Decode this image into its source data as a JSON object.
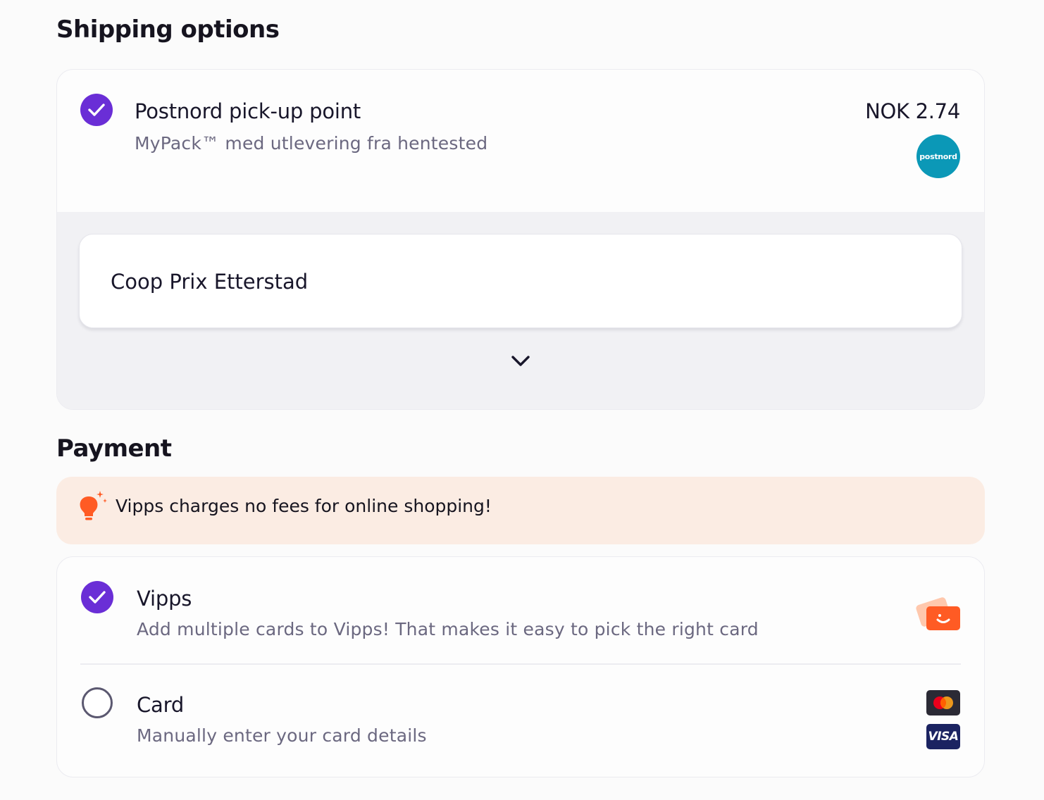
{
  "shipping": {
    "title": "Shipping options",
    "option": {
      "title": "Postnord pick-up point",
      "subtitle": "MyPack™ med utlevering fra hentested",
      "price": "NOK 2.74",
      "selected": true,
      "logo_text": "postnord",
      "logo_color": "#0b98b7"
    },
    "pickup_point": "Coop Prix Etterstad",
    "expand_icon": "chevron-down-icon"
  },
  "payment": {
    "title": "Payment",
    "promo_text": "Vipps charges no fees for online shopping!",
    "promo_icon": "lightbulb-icon",
    "options": [
      {
        "title": "Vipps",
        "subtitle": "Add multiple cards to Vipps! That makes it easy to pick the right card",
        "selected": true,
        "logo": "vipps-logo"
      },
      {
        "title": "Card",
        "subtitle": "Manually enter your card details",
        "selected": false,
        "logos": [
          "mastercard-logo",
          "visa-logo"
        ],
        "visa_text": "VISA"
      }
    ]
  },
  "colors": {
    "accent": "#6a2ed6",
    "promo_bg": "#fbece3",
    "vipps_orange": "#ff5b24"
  }
}
